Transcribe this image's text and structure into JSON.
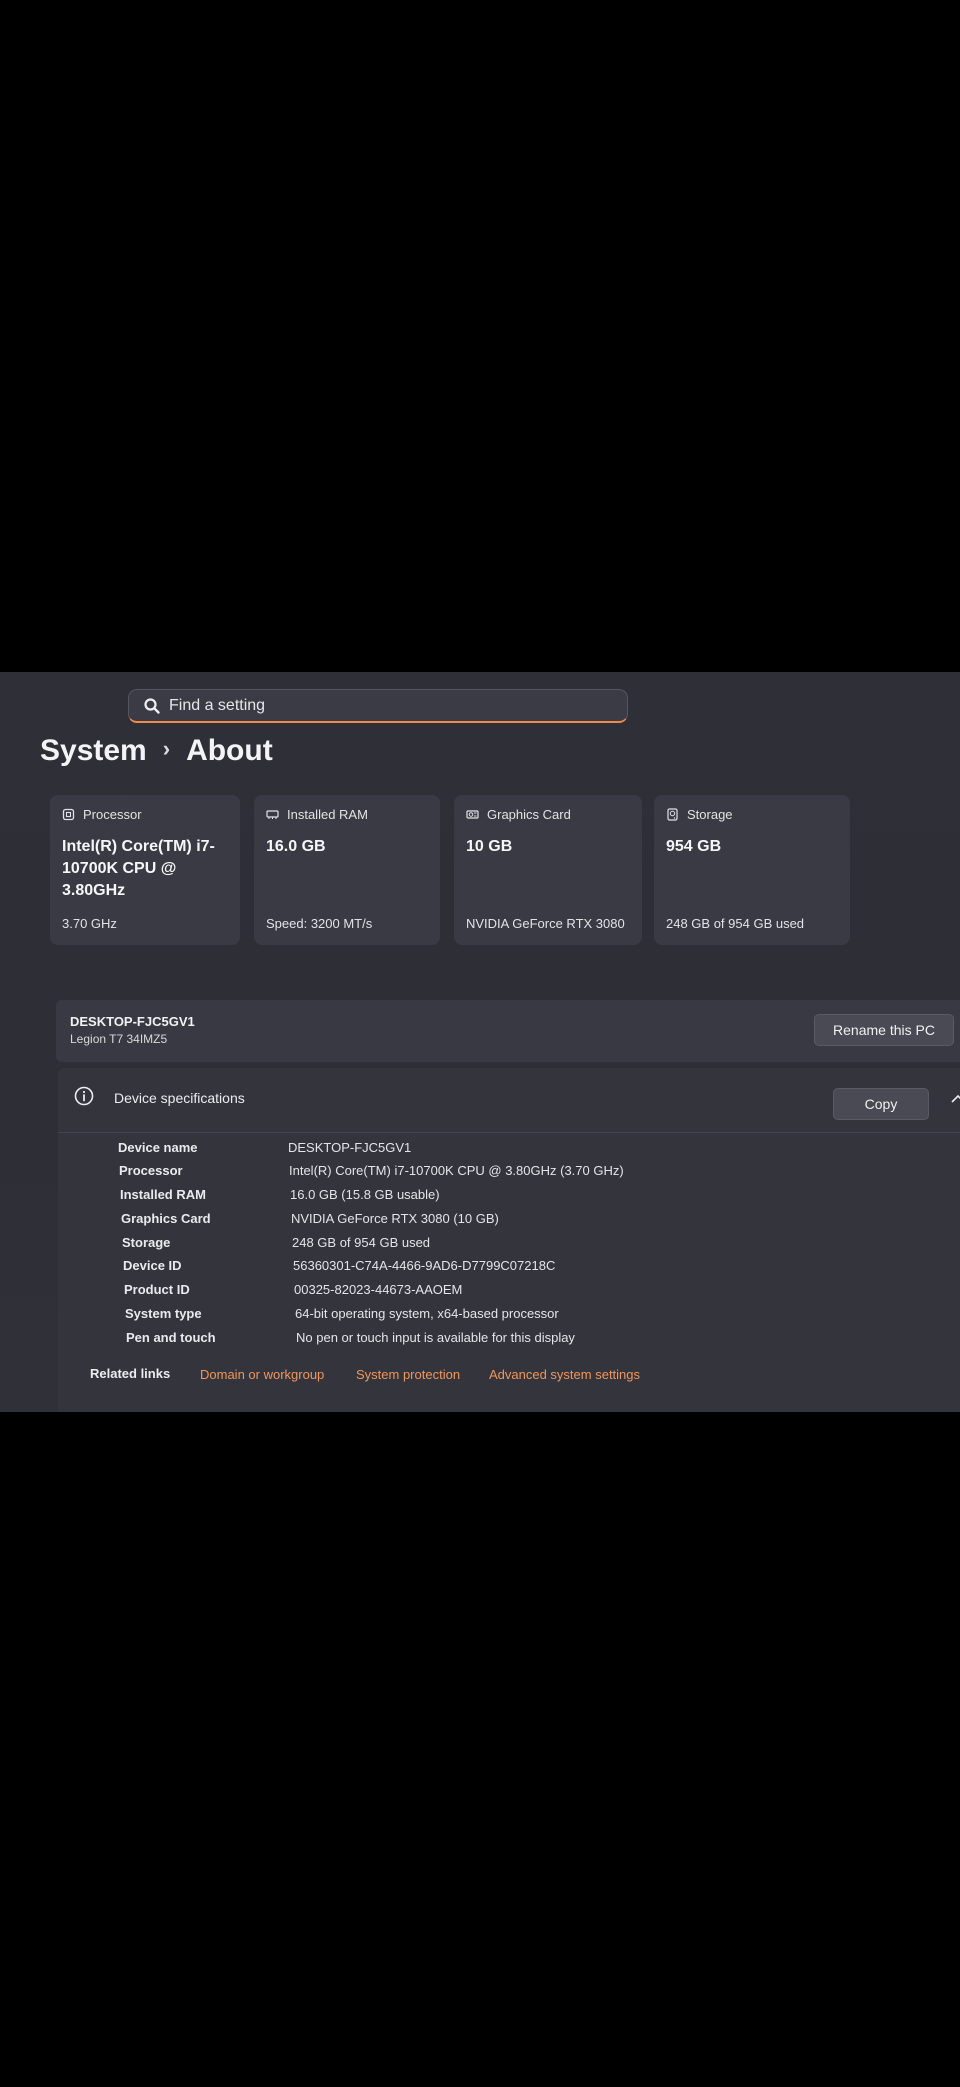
{
  "search": {
    "placeholder": "Find a setting",
    "icon": "search-icon"
  },
  "header": {
    "section": "System",
    "separator": "›",
    "page": "About"
  },
  "cards": [
    {
      "title": "Processor",
      "icon": "processor-icon",
      "value": "Intel(R) Core(TM) i7-10700K CPU @ 3.80GHz",
      "sub": "3.70 GHz"
    },
    {
      "title": "Installed RAM",
      "icon": "ram-icon",
      "value": "16.0 GB",
      "sub": "Speed: 3200 MT/s"
    },
    {
      "title": "Graphics Card",
      "icon": "graphics-card-icon",
      "value": "10 GB",
      "sub": "NVIDIA GeForce RTX 3080"
    },
    {
      "title": "Storage",
      "icon": "storage-icon",
      "value": "954 GB",
      "sub": "248 GB of 954 GB used"
    }
  ],
  "device": {
    "name": "DESKTOP-FJC5GV1",
    "model": "Legion T7 34IMZ5",
    "rename_label": "Rename this PC"
  },
  "specs": {
    "title": "Device specifications",
    "copy_label": "Copy",
    "rows": [
      {
        "key": "Device name",
        "value": "DESKTOP-FJC5GV1"
      },
      {
        "key": "Processor",
        "value": "Intel(R) Core(TM) i7-10700K CPU @ 3.80GHz (3.70 GHz)"
      },
      {
        "key": "Installed RAM",
        "value": "16.0 GB (15.8 GB usable)"
      },
      {
        "key": "Graphics Card",
        "value": "NVIDIA GeForce RTX 3080 (10 GB)"
      },
      {
        "key": "Storage",
        "value": "248 GB of 954 GB used"
      },
      {
        "key": "Device ID",
        "value": "56360301-C74A-4466-9AD6-D7799C07218C"
      },
      {
        "key": "Product ID",
        "value": "00325-82023-44673-AAOEM"
      },
      {
        "key": "System type",
        "value": "64-bit operating system, x64-based processor"
      },
      {
        "key": "Pen and touch",
        "value": "No pen or touch input is available for this display"
      }
    ]
  },
  "related": {
    "label": "Related links",
    "links": [
      "Domain or workgroup",
      "System protection",
      "Advanced system settings"
    ]
  },
  "colors": {
    "accent": "#f0894a",
    "link": "#f0965a",
    "background": "#2f2f38"
  }
}
